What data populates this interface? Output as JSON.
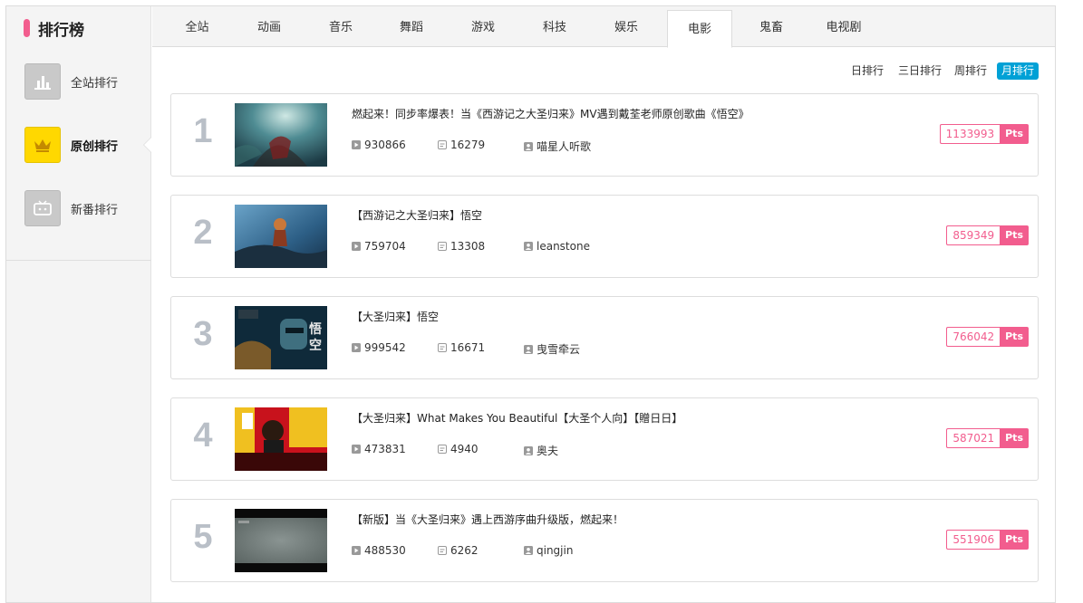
{
  "sidebar": {
    "title": "排行榜",
    "items": [
      {
        "label": "全站排行",
        "icon": "bar-chart-icon"
      },
      {
        "label": "原创排行",
        "icon": "crown-icon"
      },
      {
        "label": "新番排行",
        "icon": "tv-icon"
      }
    ]
  },
  "tabs": [
    "全站",
    "动画",
    "音乐",
    "舞蹈",
    "游戏",
    "科技",
    "娱乐",
    "电影",
    "鬼畜",
    "电视剧"
  ],
  "active_tab": "电影",
  "periods": [
    "日排行",
    "三日排行",
    "周排行",
    "月排行"
  ],
  "active_period": "月排行",
  "ranks": [
    {
      "rank": "1",
      "title": "燃起来！同步率爆表！当《西游记之大圣归来》MV遇到戴荃老师原创歌曲《悟空》",
      "plays": "930866",
      "danmaku": "16279",
      "author": "喵星人听歌",
      "pts": "1133993",
      "pts_unit": "Pts"
    },
    {
      "rank": "2",
      "title": "【西游记之大圣归来】悟空",
      "plays": "759704",
      "danmaku": "13308",
      "author": "leanstone",
      "pts": "859349",
      "pts_unit": "Pts"
    },
    {
      "rank": "3",
      "title": "【大圣归来】悟空",
      "plays": "999542",
      "danmaku": "16671",
      "author": "曳雪牵云",
      "pts": "766042",
      "pts_unit": "Pts"
    },
    {
      "rank": "4",
      "title": "【大圣归来】What Makes You Beautiful【大圣个人向】【贈日日】",
      "plays": "473831",
      "danmaku": "4940",
      "author": "奥夫",
      "pts": "587021",
      "pts_unit": "Pts"
    },
    {
      "rank": "5",
      "title": "【新版】当《大圣归来》遇上西游序曲升级版，燃起来！",
      "plays": "488530",
      "danmaku": "6262",
      "author": "qingjin",
      "pts": "551906",
      "pts_unit": "Pts"
    }
  ],
  "colors": {
    "accent_pink": "#f25d8e",
    "accent_blue": "#00a1d6",
    "rank_gray": "#b9bfc7"
  }
}
